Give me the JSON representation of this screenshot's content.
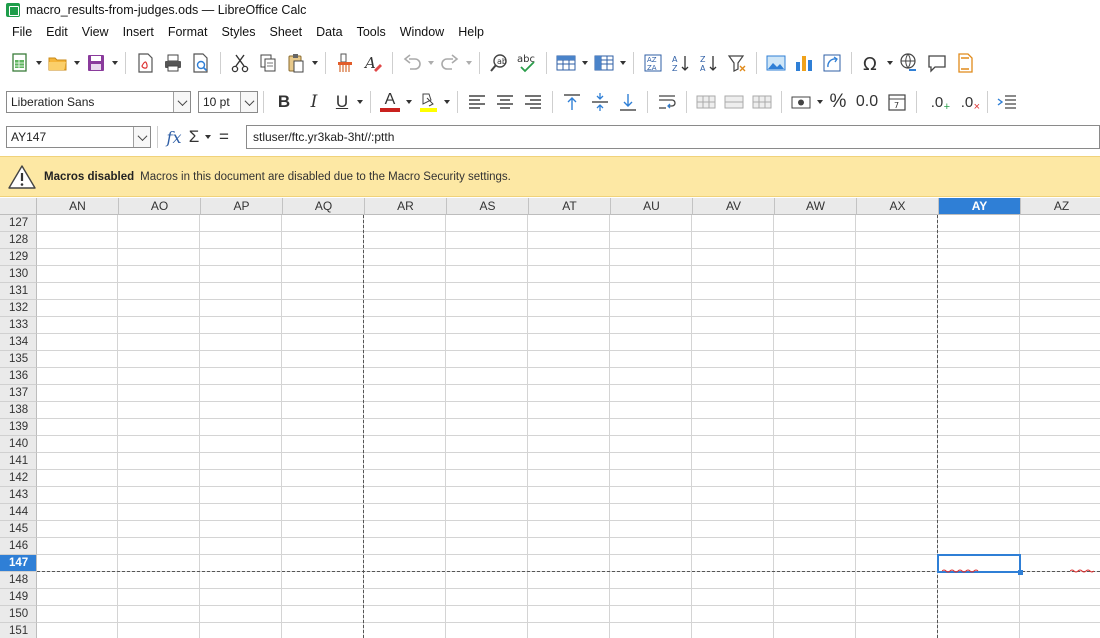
{
  "window": {
    "title": "macro_results-from-judges.ods — LibreOffice Calc"
  },
  "menu": [
    "File",
    "Edit",
    "View",
    "Insert",
    "Format",
    "Styles",
    "Sheet",
    "Data",
    "Tools",
    "Window",
    "Help"
  ],
  "toolbar2": {
    "font_name": "Liberation Sans",
    "font_size": "10 pt",
    "bold": "B",
    "italic": "I",
    "underline": "U",
    "font_color_letter": "A",
    "percent": "%",
    "decimal_zero": "0.0",
    "add_decimal": ".0",
    "remove_decimal": ".0"
  },
  "formula_bar": {
    "name_box": "AY147",
    "function_wizard": "fx",
    "sum": "Σ",
    "equals": "=",
    "content": "stluser/ftc.yr3kab-3ht//:ptth"
  },
  "infobar": {
    "title": "Macros disabled",
    "message": "Macros in this document are disabled due to the Macro Security settings."
  },
  "grid": {
    "columns": [
      "AN",
      "AO",
      "AP",
      "AQ",
      "AR",
      "AS",
      "AT",
      "AU",
      "AV",
      "AW",
      "AX",
      "AY",
      "AZ"
    ],
    "active_column": "AY",
    "rows": [
      "127",
      "128",
      "129",
      "130",
      "131",
      "132",
      "133",
      "134",
      "135",
      "136",
      "137",
      "138",
      "139",
      "140",
      "141",
      "142",
      "143",
      "144",
      "145",
      "146",
      "147",
      "148",
      "149",
      "150",
      "151"
    ],
    "active_row": "147"
  },
  "colors": {
    "accent": "#2f7fd6",
    "infobar_bg": "#fde8a4",
    "header_bg": "#eaeaea",
    "app_green": "#1e9d4a"
  }
}
